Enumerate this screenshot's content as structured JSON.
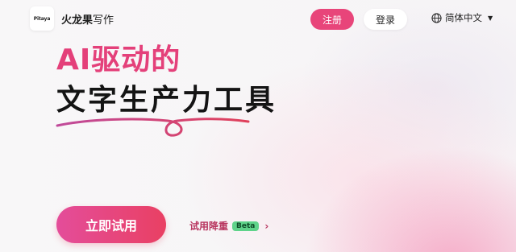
{
  "header": {
    "logo_text": "Pitaya",
    "brand_name": "火龙果",
    "brand_suffix": "写作",
    "register_label": "注册",
    "login_label": "登录",
    "language_label": "简体中文"
  },
  "hero": {
    "headline_line1": "AI驱动的",
    "headline_line2": "文字生产力工具",
    "cta_label": "立即试用",
    "secondary_link_label": "试用降重",
    "secondary_badge": "Beta"
  },
  "colors": {
    "accent": "#e8457a",
    "cta_start": "#e44d9a",
    "cta_end": "#e94063",
    "badge": "#5fd38a"
  },
  "icons": {
    "language": "globe-icon",
    "language_dropdown": "caret-down-icon",
    "secondary_link": "chevron-right-icon"
  }
}
